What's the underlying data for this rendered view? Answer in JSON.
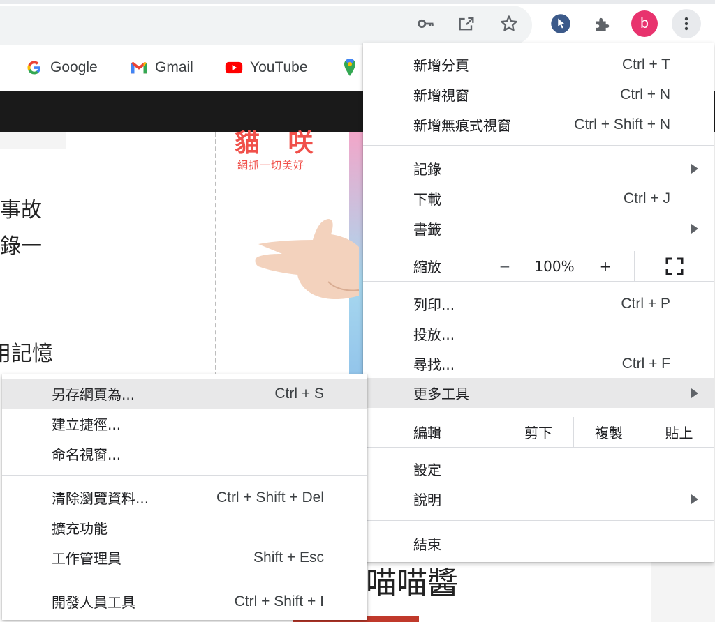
{
  "toolbar": {
    "icons": [
      "key-icon",
      "share-icon",
      "star-icon",
      "cursor-extension-icon",
      "puzzle-extensions-icon",
      "profile-avatar",
      "more-vert-icon"
    ],
    "profile_initial": "b",
    "profile_color": "#e8336e"
  },
  "bookmarks": [
    {
      "label": "Google",
      "icon": "google-icon"
    },
    {
      "label": "Gmail",
      "icon": "gmail-icon"
    },
    {
      "label": "YouTube",
      "icon": "youtube-icon"
    },
    {
      "label": "",
      "icon": "maps-icon"
    }
  ],
  "page": {
    "text_1": "事故",
    "text_2": "錄一",
    "text_3": "用記憶",
    "promo_title": "貓 咲",
    "promo_sub": "網抓一切美好",
    "bottom_text": "喵喵醬"
  },
  "main_menu": {
    "new_tab": {
      "label": "新增分頁",
      "shortcut": "Ctrl + T"
    },
    "new_window": {
      "label": "新增視窗",
      "shortcut": "Ctrl + N"
    },
    "new_incognito": {
      "label": "新增無痕式視窗",
      "shortcut": "Ctrl + Shift + N"
    },
    "history": {
      "label": "記錄"
    },
    "downloads": {
      "label": "下載",
      "shortcut": "Ctrl + J"
    },
    "bookmarks": {
      "label": "書籤"
    },
    "zoom": {
      "label": "縮放",
      "minus": "−",
      "value": "100%",
      "plus": "+"
    },
    "print": {
      "label": "列印...",
      "shortcut": "Ctrl + P"
    },
    "cast": {
      "label": "投放..."
    },
    "find": {
      "label": "尋找...",
      "shortcut": "Ctrl + F"
    },
    "more_tools": {
      "label": "更多工具"
    },
    "edit": {
      "label": "編輯",
      "cut": "剪下",
      "copy": "複製",
      "paste": "貼上"
    },
    "settings": {
      "label": "設定"
    },
    "help": {
      "label": "說明"
    },
    "exit": {
      "label": "結束"
    }
  },
  "sub_menu": {
    "save_page": {
      "label": "另存網頁為...",
      "shortcut": "Ctrl + S"
    },
    "create_shortcut": {
      "label": "建立捷徑..."
    },
    "name_window": {
      "label": "命名視窗..."
    },
    "clear_data": {
      "label": "清除瀏覽資料...",
      "shortcut": "Ctrl + Shift + Del"
    },
    "extensions": {
      "label": "擴充功能"
    },
    "task_manager": {
      "label": "工作管理員",
      "shortcut": "Shift + Esc"
    },
    "dev_tools": {
      "label": "開發人員工具",
      "shortcut": "Ctrl + Shift + I"
    }
  },
  "colors": {
    "menu_highlight": "#e8e8e9",
    "accent_red": "#f0504a",
    "youtube_red": "#ff0000"
  }
}
